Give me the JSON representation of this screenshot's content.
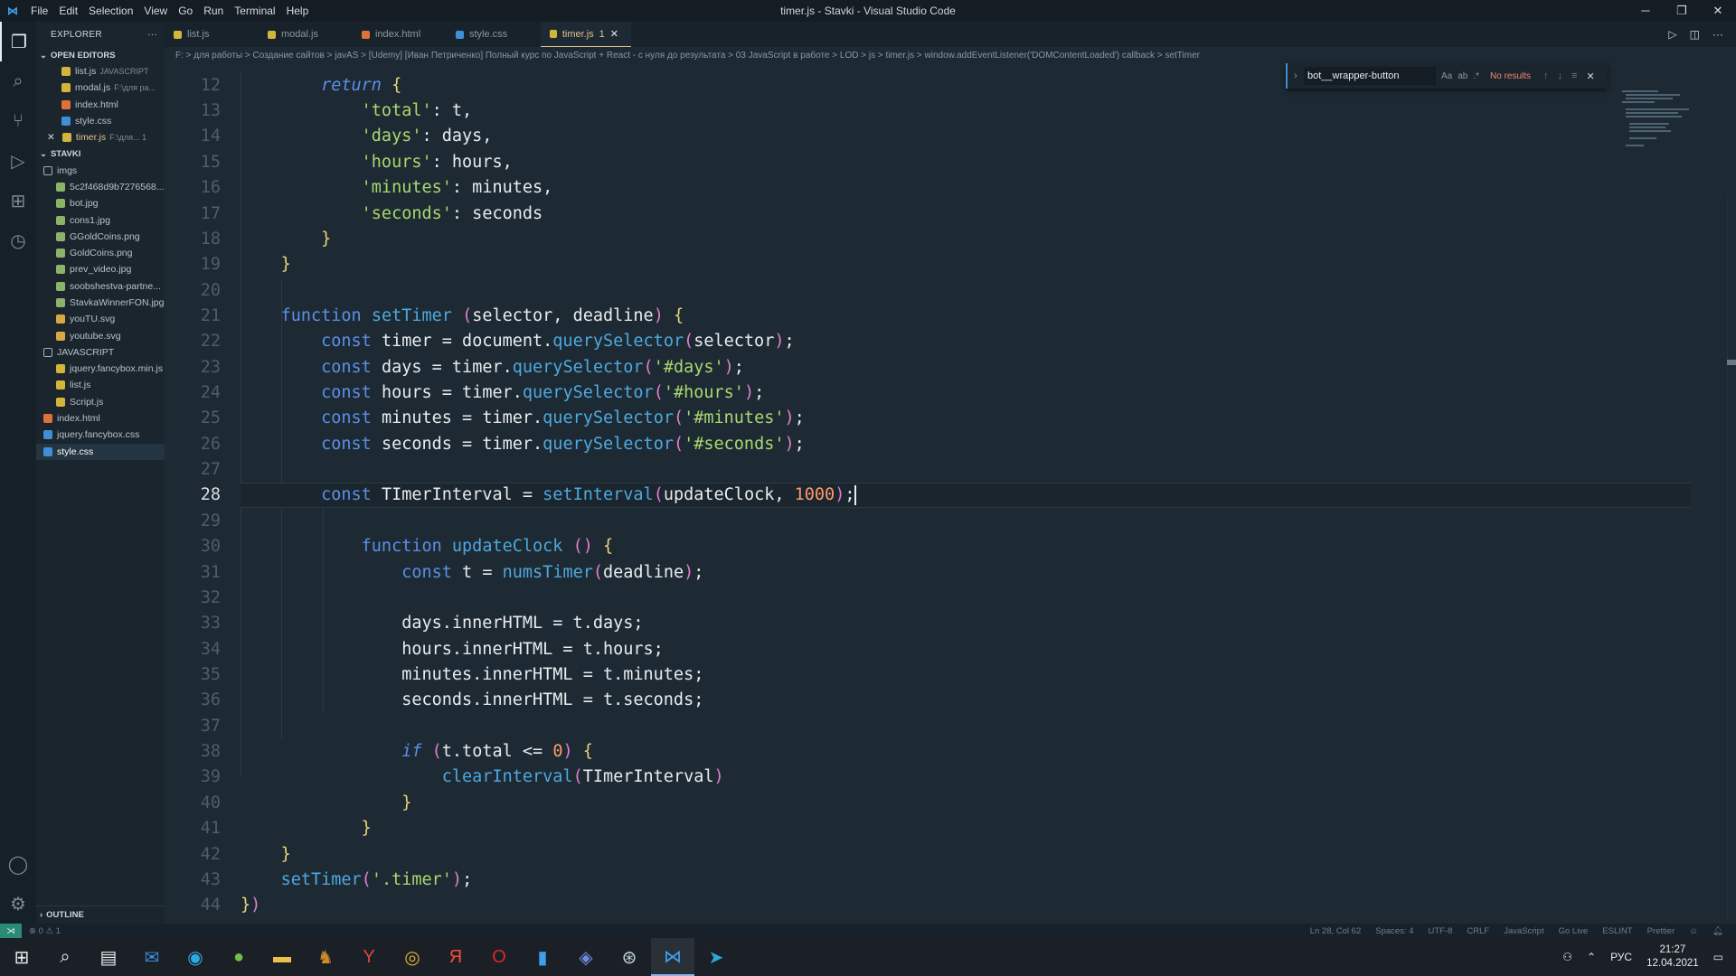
{
  "window": {
    "title": "timer.js - Stavki - Visual Studio Code",
    "menu": [
      "File",
      "Edit",
      "Selection",
      "View",
      "Go",
      "Run",
      "Terminal",
      "Help"
    ]
  },
  "sidebar": {
    "header": "EXPLORER",
    "header_more": "···",
    "open_editors_title": "OPEN EDITORS",
    "open_editors": [
      {
        "name": "list.js",
        "sub": "JAVASCRIPT",
        "type": "js"
      },
      {
        "name": "modal.js",
        "sub": "F:\\для ра...",
        "type": "js"
      },
      {
        "name": "index.html",
        "sub": "",
        "type": "html"
      },
      {
        "name": "style.css",
        "sub": "",
        "type": "css"
      },
      {
        "name": "timer.js",
        "sub": "F:\\для...  1",
        "type": "js",
        "close": "✕"
      }
    ],
    "project_title": "STAVKI",
    "tree": [
      {
        "name": "imgs",
        "type": "folder",
        "depth": 0
      },
      {
        "name": "5c2f468d9b7276568...",
        "type": "img",
        "depth": 1
      },
      {
        "name": "bot.jpg",
        "type": "img",
        "depth": 1
      },
      {
        "name": "cons1.jpg",
        "type": "img",
        "depth": 1
      },
      {
        "name": "GGoldCoins.png",
        "type": "img",
        "depth": 1
      },
      {
        "name": "GoldCoins.png",
        "type": "img",
        "depth": 1
      },
      {
        "name": "prev_video.jpg",
        "type": "img",
        "depth": 1
      },
      {
        "name": "soobshestva-partne...",
        "type": "img",
        "depth": 1
      },
      {
        "name": "StavkaWinnerFON.jpg",
        "type": "img",
        "depth": 1
      },
      {
        "name": "youTU.svg",
        "type": "svg",
        "depth": 1
      },
      {
        "name": "youtube.svg",
        "type": "svg",
        "depth": 1
      },
      {
        "name": "JAVASCRIPT",
        "type": "folder",
        "depth": 0
      },
      {
        "name": "jquery.fancybox.min.js",
        "type": "js",
        "depth": 1
      },
      {
        "name": "list.js",
        "type": "js",
        "depth": 1
      },
      {
        "name": "Script.js",
        "type": "js",
        "depth": 1
      },
      {
        "name": "index.html",
        "type": "html",
        "depth": 0
      },
      {
        "name": "jquery.fancybox.css",
        "type": "css",
        "depth": 0
      },
      {
        "name": "style.css",
        "type": "css",
        "depth": 0
      }
    ],
    "outline_title": "OUTLINE"
  },
  "tabs": [
    {
      "label": "list.js",
      "type": "js"
    },
    {
      "label": "modal.js",
      "type": "js"
    },
    {
      "label": "index.html",
      "type": "html"
    },
    {
      "label": "style.css",
      "type": "css"
    },
    {
      "label": "timer.js",
      "type": "js",
      "badge": "1",
      "close": "✕"
    }
  ],
  "breadcrumb": "F: > для работы > Создание сайтов > javAS > [Udemy] [Иван Петриченко] Полный курс по JavaScript + React - с нуля до результата > 03 JavaScript в работе > LOD > js > timer.js > window.addEventListener('DOMContentLoaded') callback > setTimer",
  "find": {
    "value": "bot__wrapper-button",
    "options": [
      "Aa",
      "ab",
      ".*"
    ],
    "status": "No results",
    "prev": "↑",
    "next": "↓",
    "menu": "≡",
    "close": "✕"
  },
  "code": {
    "current_line": "28",
    "line_numbers": [
      "12",
      "13",
      "14",
      "15",
      "16",
      "17",
      "18",
      "19",
      "20",
      "21",
      "22",
      "23",
      "24",
      "25",
      "26",
      "27",
      "28",
      "29",
      "30",
      "31",
      "32",
      "33",
      "34",
      "35",
      "36",
      "37",
      "38",
      "39",
      "40",
      "41",
      "42",
      "43",
      "44"
    ]
  },
  "statusbar": {
    "left": "⊗ 0 ⚠ 1",
    "position": "Ln 28, Col 62",
    "spaces": "Spaces: 4",
    "encoding": "UTF-8",
    "eol": "CRLF",
    "language": "JavaScript",
    "golive": "Go Live",
    "eslint": "ESLINT",
    "prettier": "Prettier"
  },
  "taskbar": {
    "lang": "РУС",
    "time": "21:27",
    "date": "12.04.2021"
  }
}
